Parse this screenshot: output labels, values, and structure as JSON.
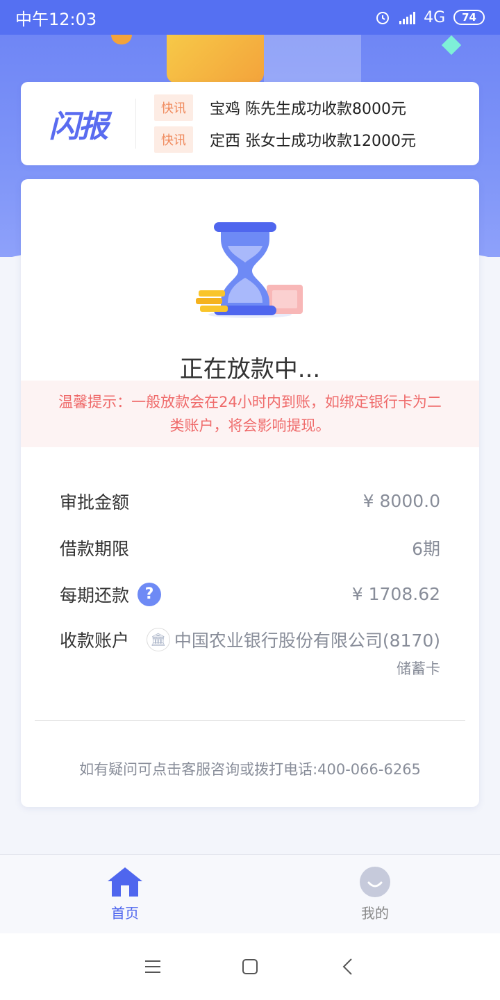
{
  "status_bar": {
    "time": "中午12:03",
    "network": "4G",
    "battery": "74"
  },
  "news": {
    "logo": "闪报",
    "items": [
      {
        "tag": "快讯",
        "text": "宝鸡 陈先生成功收款8000元"
      },
      {
        "tag": "快讯",
        "text": "定西 张女士成功收款12000元"
      }
    ]
  },
  "main": {
    "status_title": "正在放款中...",
    "notice": "温馨提示：一般放款会在24小时内到账，如绑定银行卡为二类账户，将会影响提现。",
    "rows": [
      {
        "label": "审批金额",
        "value": "¥ 8000.0"
      },
      {
        "label": "借款期限",
        "value": "6期"
      },
      {
        "label": "每期还款",
        "value": "¥ 1708.62"
      }
    ],
    "account": {
      "label": "收款账户",
      "bank": "中国农业银行股份有限公司(8170)",
      "card_type": "储蓄卡"
    },
    "contact": "如有疑问可点击客服咨询或拨打电话:400-066-6265"
  },
  "tabs": [
    {
      "label": "首页",
      "icon": "home-icon",
      "active": true
    },
    {
      "label": "我的",
      "icon": "profile-icon",
      "active": false
    }
  ],
  "colors": {
    "primary": "#5570f2",
    "notice_text": "#ef6a6a",
    "tag_text": "#f08a5d"
  }
}
